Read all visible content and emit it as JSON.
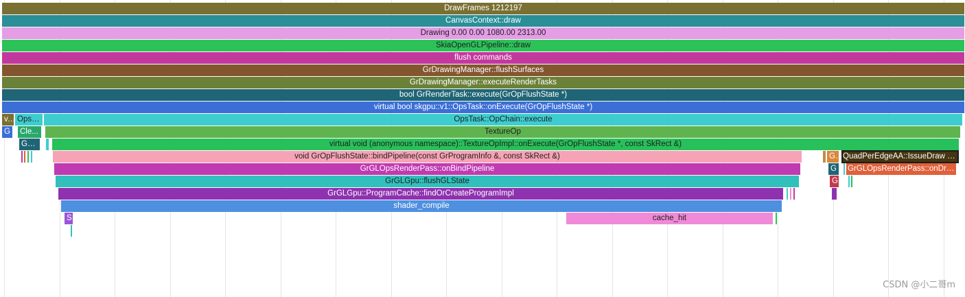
{
  "watermark": "CSDN @小二哥m",
  "slices": {
    "draw_frames": "DrawFrames 1212197",
    "canvas_context_draw": "CanvasContext::draw",
    "drawing": "Drawing  0.00  0.00 1080.00 2313.00",
    "skia_pipeline_draw": "SkiaOpenGLPipeline::draw",
    "flush_commands": "flush commands",
    "flush_surfaces": "GrDrawingManager::flushSurfaces",
    "execute_render_tasks": "GrDrawingManager::executeRenderTasks",
    "render_task_execute": "bool GrRenderTask::execute(GrOpFlushState *)",
    "ops_task_on_execute": "virtual bool skgpu::v1::OpsTask::onExecute(GrOpFlushState *)",
    "v_short": "v...",
    "opst_short": "OpsT...",
    "op_chain_execute": "OpsTask::OpChain::execute",
    "g_short": "G",
    "cle_short": "Cle...",
    "texture_op": "TextureOp",
    "grg_short": "GrG...",
    "texture_op_impl_on_execute": "virtual void (anonymous namespace)::TextureOpImpl::onExecute(GrOpFlushState *, const SkRect &)",
    "bind_pipeline": "void GrOpFlushState::bindPipeline(const GrProgramInfo &, const SkRect &)",
    "g_dots_short": "G...",
    "quad_issue_draw": "QuadPerEdgeAA::IssueDraw kT...",
    "render_pass_bind_pipeline": "GrGLOpsRenderPass::onBindPipeline",
    "g_short_2": "G",
    "render_pass_on_draw": "GrGLOpsRenderPass::onDraw",
    "flush_gl_state": "GrGLGpu::flushGLState",
    "g_short_3": "G",
    "find_or_create_program": "GrGLGpu::ProgramCache::findOrCreateProgramImpl",
    "shader_compile": "shader_compile",
    "s_short": "S",
    "cache_hit": "cache_hit"
  },
  "colors": {
    "draw_frames": "#7a7032",
    "canvas_context_draw": "#2a8f97",
    "drawing": "#e59de6",
    "skia_pipeline_draw": "#2cc258",
    "flush_commands": "#c2399d",
    "flush_surfaces": "#845630",
    "execute_render_tasks": "#6b8137",
    "render_task_execute": "#1f6575",
    "ops_task_on_execute": "#3b6fd6",
    "op_chain_execute": "#3ecdcf",
    "texture_op": "#5fb44f",
    "texture_op_impl_on_execute": "#28c05a",
    "bind_pipeline": "#f6a3b5",
    "render_pass_bind_pipeline": "#c03ab1",
    "flush_gl_state": "#31c0bb",
    "find_or_create_program": "#8e32b0",
    "shader_compile": "#4e8fe0",
    "cache_hit": "#f08ad8",
    "quad_issue_draw": "#4b3714",
    "render_pass_on_draw": "#e0603a"
  }
}
